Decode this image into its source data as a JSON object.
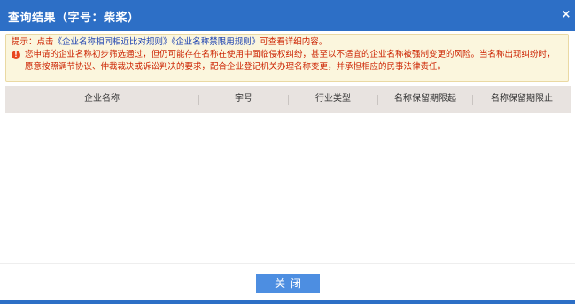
{
  "dialog": {
    "title": "查询结果（字号：柴桨）",
    "close_icon": "close-icon",
    "close_glyph": "×"
  },
  "notice": {
    "prefix": "提示：点击",
    "link1": "《企业名称相同相近比对规则》",
    "link2": "《企业名称禁限用规则》",
    "suffix": "可查看详细内容。",
    "warning_icon": "exclamation-circle-icon",
    "warning_glyph": "!",
    "warning_text": "您申请的企业名称初步筛选通过，但仍可能存在名称在使用中面临侵权纠纷，甚至以不适宜的企业名称被强制变更的风险。当名称出现纠纷时，愿意按照调节协议、仲裁裁决或诉讼判决的要求，配合企业登记机关办理名称变更，并承担相应的民事法律责任。"
  },
  "table": {
    "columns": [
      "企业名称",
      "字号",
      "行业类型",
      "名称保留期限起",
      "名称保留期限止"
    ],
    "rows": []
  },
  "footer": {
    "close_label": "关闭"
  },
  "colors": {
    "title_bar": "#2d6fc6",
    "notice_bg": "#fbf6dd",
    "notice_text": "#cc2200",
    "notice_link": "#1a3fb0",
    "table_header_bg": "#e8e3e0",
    "button": "#4d8ee1"
  }
}
